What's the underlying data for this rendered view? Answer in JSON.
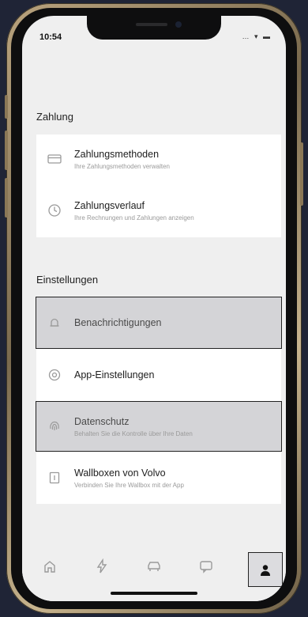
{
  "status": {
    "time": "10:54",
    "icons": "… ▾ ▬"
  },
  "sections": [
    {
      "title": "Zahlung",
      "items": [
        {
          "icon": "card-icon",
          "title": "Zahlungsmethoden",
          "subtitle": "Ihre Zahlungsmethoden verwalten"
        },
        {
          "icon": "clock-icon",
          "title": "Zahlungsverlauf",
          "subtitle": "Ihre Rechnungen und Zahlungen anzeigen"
        }
      ]
    },
    {
      "title": "Einstellungen",
      "items": [
        {
          "icon": "bell-icon",
          "title": "Benachrichtigungen",
          "subtitle": ""
        },
        {
          "icon": "gear-icon",
          "title": "App-Einstellungen",
          "subtitle": ""
        },
        {
          "icon": "fingerprint-icon",
          "title": "Datenschutz",
          "subtitle": "Behalten Sie die Kontrolle über Ihre Daten"
        },
        {
          "icon": "wallbox-icon",
          "title": "Wallboxen von Volvo",
          "subtitle": "Verbinden Sie Ihre Wallbox mit der App"
        }
      ]
    }
  ],
  "tabs": [
    {
      "name": "home",
      "icon": "home-icon"
    },
    {
      "name": "charging",
      "icon": "bolt-icon"
    },
    {
      "name": "car",
      "icon": "car-icon"
    },
    {
      "name": "messages",
      "icon": "chat-icon"
    },
    {
      "name": "profile",
      "icon": "person-icon",
      "active": true
    }
  ]
}
